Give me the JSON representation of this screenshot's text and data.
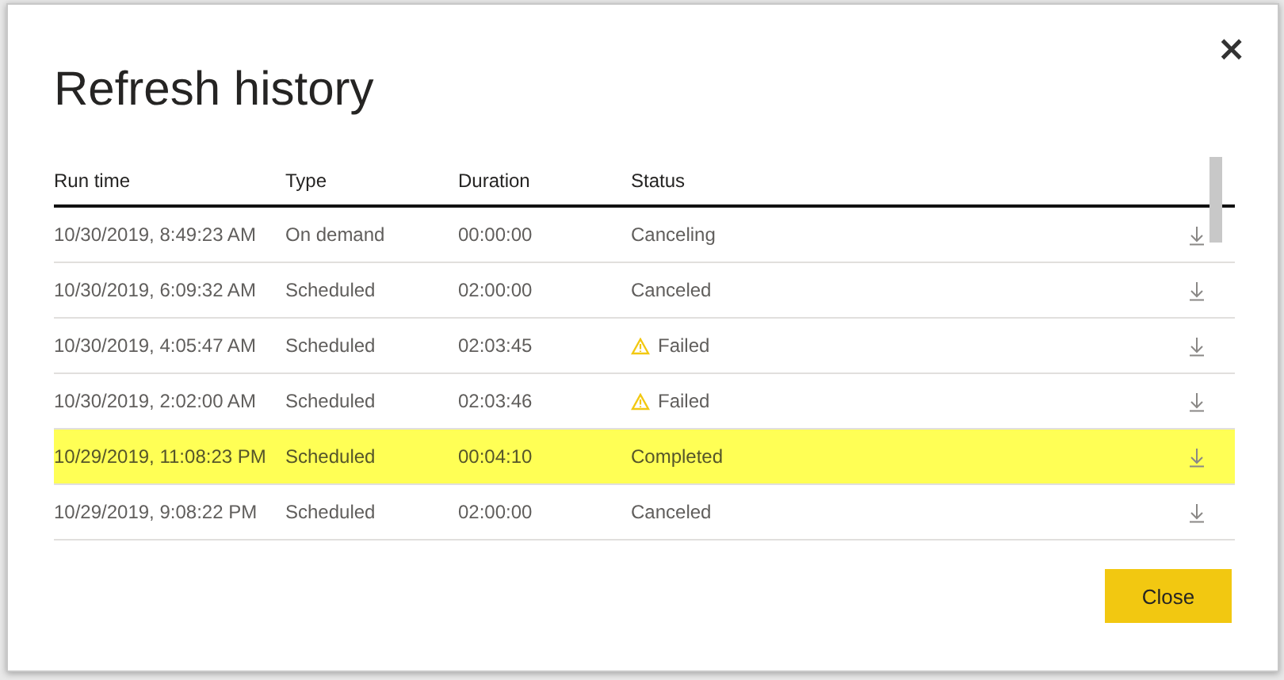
{
  "dialog": {
    "title": "Refresh history",
    "close_icon": "×"
  },
  "table": {
    "columns": [
      "Run time",
      "Type",
      "Duration",
      "Status"
    ],
    "rows": [
      {
        "run_time": "10/30/2019, 8:49:23 AM",
        "type": "On demand",
        "duration": "00:00:00",
        "status": "Canceling",
        "warning": false,
        "selected": false
      },
      {
        "run_time": "10/30/2019, 6:09:32 AM",
        "type": "Scheduled",
        "duration": "02:00:00",
        "status": "Canceled",
        "warning": false,
        "selected": false
      },
      {
        "run_time": "10/30/2019, 4:05:47 AM",
        "type": "Scheduled",
        "duration": "02:03:45",
        "status": "Failed",
        "warning": true,
        "selected": false
      },
      {
        "run_time": "10/30/2019, 2:02:00 AM",
        "type": "Scheduled",
        "duration": "02:03:46",
        "status": "Failed",
        "warning": true,
        "selected": false
      },
      {
        "run_time": "10/29/2019, 11:08:23 PM",
        "type": "Scheduled",
        "duration": "00:04:10",
        "status": "Completed",
        "warning": false,
        "selected": true
      },
      {
        "run_time": "10/29/2019, 9:08:22 PM",
        "type": "Scheduled",
        "duration": "02:00:00",
        "status": "Canceled",
        "warning": false,
        "selected": false
      }
    ]
  },
  "buttons": [
    "Close"
  ]
}
